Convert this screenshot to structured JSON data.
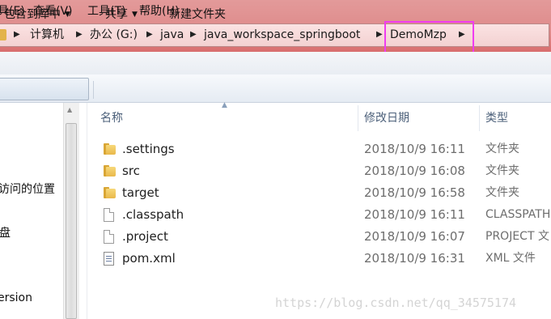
{
  "address_bar": {
    "crumbs": [
      "计算机",
      "办公 (G:)",
      "java",
      "java_workspace_springboot",
      "DemoMzp"
    ]
  },
  "menu": {
    "items": [
      "具(E)",
      "查看(V)",
      "工具(T)",
      "帮助(H)"
    ]
  },
  "toolbar": {
    "include_library": "包含到库中",
    "share": "共享",
    "new_folder": "新建文件夹"
  },
  "nav_pane": {
    "items": [
      "访问的位置",
      "盘",
      "ersion"
    ]
  },
  "columns": {
    "name": "名称",
    "date": "修改日期",
    "type": "类型"
  },
  "files": [
    {
      "name": ".settings",
      "date": "2018/10/9 16:11",
      "type": "文件夹",
      "icon": "folder-icon"
    },
    {
      "name": "src",
      "date": "2018/10/9 16:08",
      "type": "文件夹",
      "icon": "folder-icon"
    },
    {
      "name": "target",
      "date": "2018/10/9 16:58",
      "type": "文件夹",
      "icon": "folder-icon"
    },
    {
      "name": ".classpath",
      "date": "2018/10/9 16:11",
      "type": "CLASSPATH",
      "icon": "file-icon"
    },
    {
      "name": ".project",
      "date": "2018/10/9 16:07",
      "type": "PROJECT 文",
      "icon": "file-icon"
    },
    {
      "name": "pom.xml",
      "date": "2018/10/9 16:31",
      "type": "XML 文件",
      "icon": "xml-file-icon"
    }
  ],
  "watermark": "https://blog.csdn.net/qq_34575174",
  "colors": {
    "address_band": "#de8a8a",
    "highlight_box": "#f03cf0",
    "column_header_text": "#4c607a",
    "secondary_text": "#6d6d6d"
  }
}
